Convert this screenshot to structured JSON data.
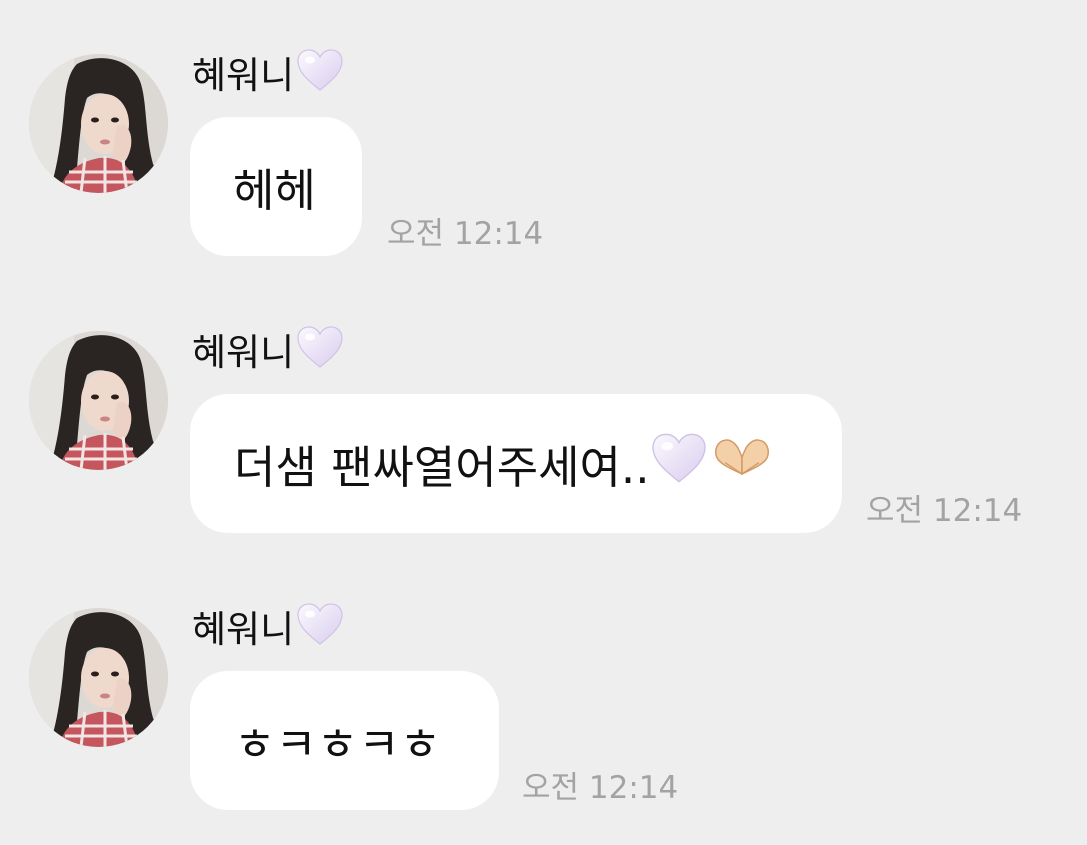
{
  "messages": [
    {
      "sender": "혜워니",
      "sender_emoji": "white-heart-icon",
      "text": "헤헤",
      "time": "오전 12:14"
    },
    {
      "sender": "혜워니",
      "sender_emoji": "white-heart-icon",
      "text": "더샘 팬싸열어주세여..",
      "trailing_emojis": [
        "white-heart-icon",
        "heart-hands-icon"
      ],
      "time": "오전 12:14"
    },
    {
      "sender": "혜워니",
      "sender_emoji": "white-heart-icon",
      "text": "ㅎㅋㅎㅋㅎ",
      "time": "오전 12:14"
    }
  ],
  "colors": {
    "background": "#eeeeee",
    "bubble": "#ffffff",
    "text": "#111111",
    "timestamp": "#a3a3a3",
    "heart": "#e6dcf5"
  }
}
